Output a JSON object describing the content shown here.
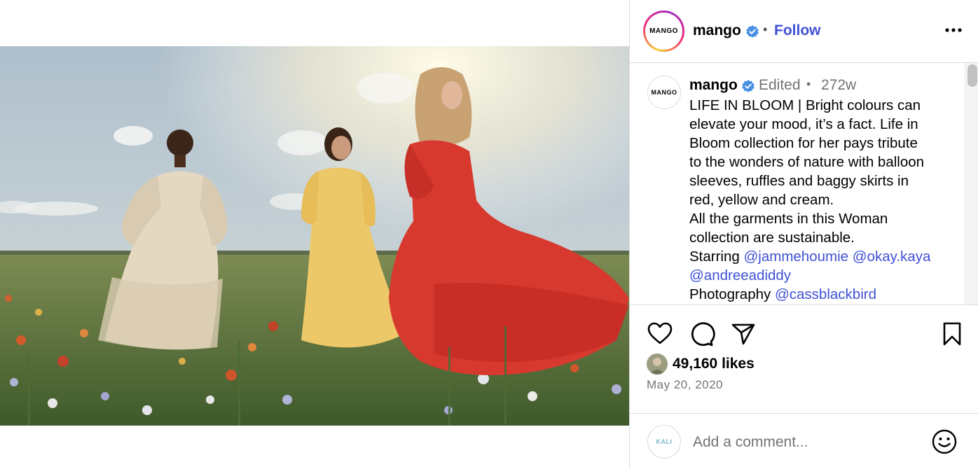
{
  "header": {
    "avatar_text": "MANGO",
    "username": "mango",
    "separator": "•",
    "follow_label": "Follow"
  },
  "caption": {
    "avatar_text": "MANGO",
    "username": "mango",
    "edited": "Edited",
    "separator": "•",
    "time": "272w",
    "lines": [
      "LIFE IN BLOOM | Bright colours can",
      "elevate your mood, it’s a fact. Life in",
      "Bloom collection for her pays tribute",
      "to the wonders of nature with balloon",
      "sleeves, ruffles and baggy skirts in",
      "red, yellow and cream.",
      "All the garments in this Woman",
      "collection are sustainable."
    ],
    "starring_label": "Starring",
    "mention_1": "@jammehoumie",
    "mention_2": "@okay.kaya",
    "mention_3": "@andreeadiddy",
    "photography_label": "Photography",
    "mention_4": "@cassblackbird"
  },
  "actions": {
    "like_icon": "heart-icon",
    "comment_icon": "comment-icon",
    "share_icon": "paper-plane-icon",
    "save_icon": "bookmark-icon"
  },
  "stats": {
    "likes": "49,160 likes",
    "date": "May 20, 2020"
  },
  "comment_box": {
    "avatar_text": "KALI",
    "placeholder": "Add a comment...",
    "emoji_icon": "smiley-icon"
  },
  "colors": {
    "link_blue": "#3f51d6",
    "verified_blue": "#4a90e2",
    "muted": "#737373",
    "border": "#dbdbdb"
  }
}
